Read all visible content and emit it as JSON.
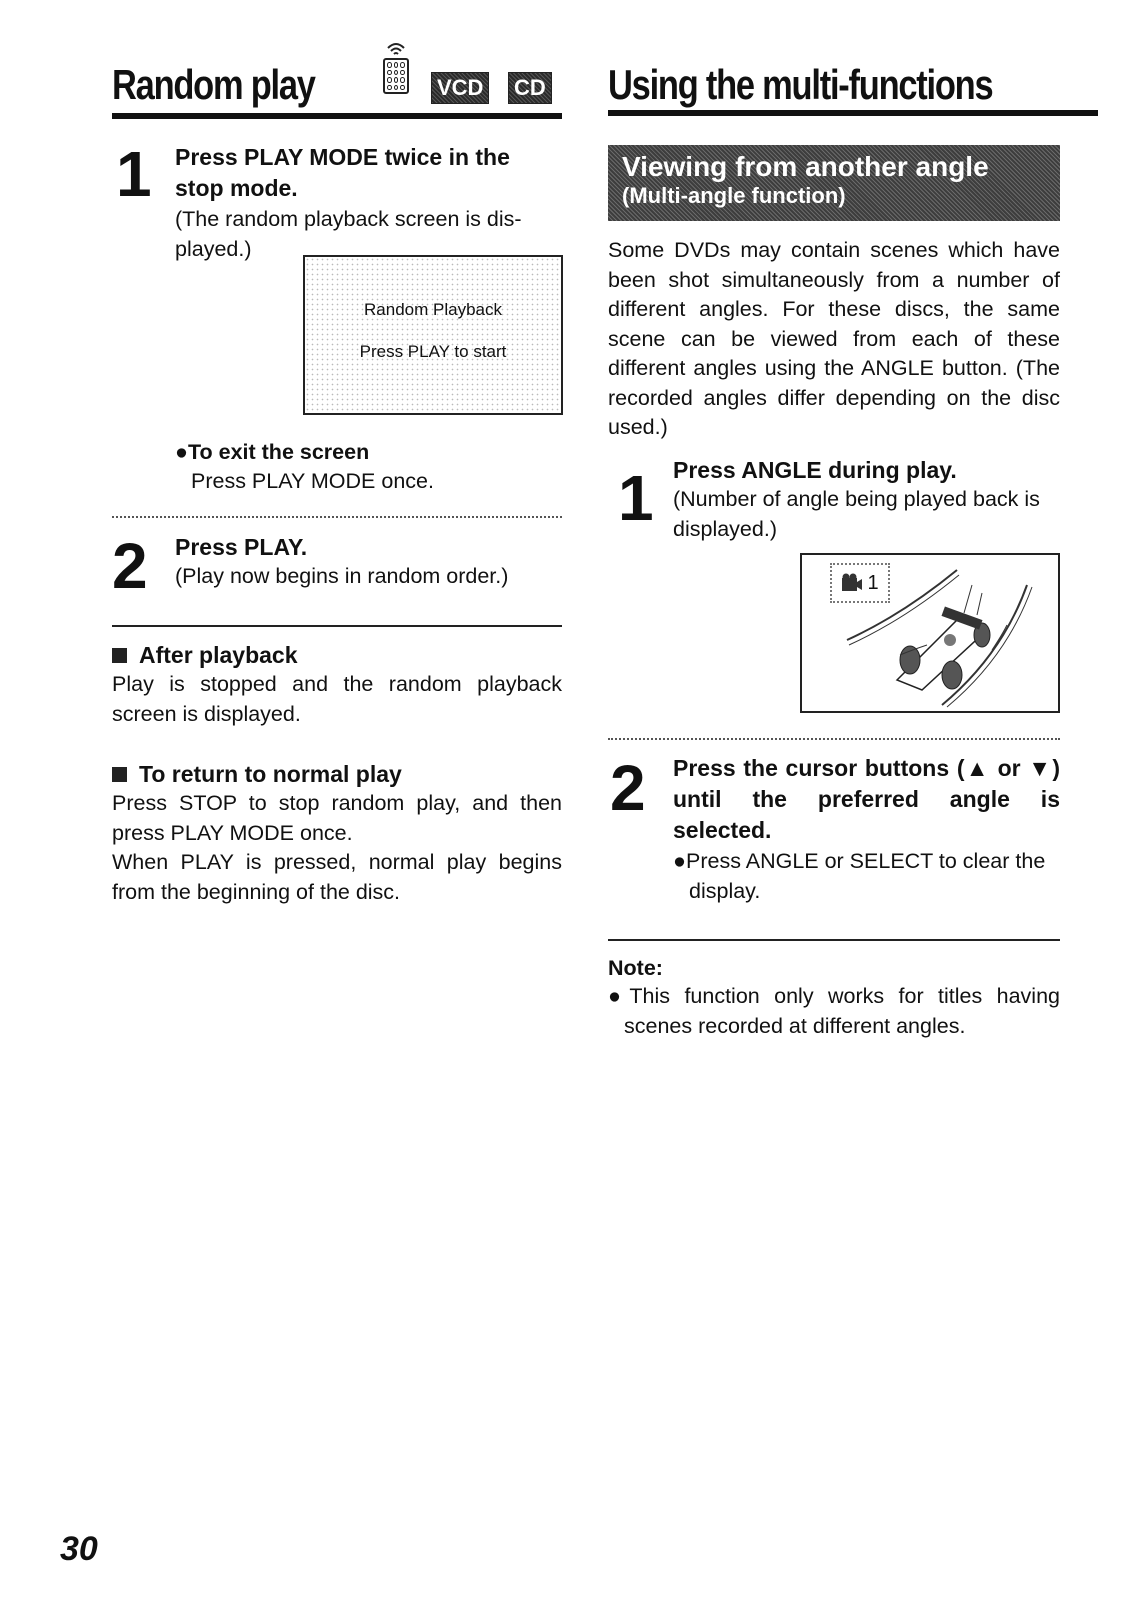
{
  "page_number": "30",
  "left": {
    "title": "Random play",
    "icons": [
      "remote-control-icon"
    ],
    "badges": [
      "VCD",
      "CD"
    ],
    "step1": {
      "number": "1",
      "heading": "Press PLAY MODE twice in the stop mode.",
      "heading_line1": "Press PLAY MODE twice in the",
      "heading_line2": "stop mode.",
      "body_line1": "(The random playback screen is dis-",
      "body_line2": "played.)",
      "screen": {
        "line1": "Random Playback",
        "line2": "Press PLAY to start"
      },
      "exit_heading": "●To exit the screen",
      "exit_body": "Press PLAY MODE once."
    },
    "step2": {
      "number": "2",
      "heading": "Press PLAY.",
      "body": "(Play now begins in random order.)"
    },
    "after_playback": {
      "heading": "After playback",
      "body": "Play is stopped and the random playback screen is displayed."
    },
    "return_normal": {
      "heading": "To return to normal play",
      "body1": "Press STOP to stop random play, and then press PLAY MODE once.",
      "body2": "When PLAY is pressed, normal play begins from the beginning of the disc."
    }
  },
  "right": {
    "title": "Using the multi-functions",
    "banner": {
      "line1": "Viewing from another angle",
      "line2": "(Multi-angle function)"
    },
    "intro": "Some DVDs may contain scenes which have been shot simultaneously from a number of different angles. For these discs, the same scene can be viewed from each of these different angles using the ANGLE button. (The recorded angles differ depending on the disc used.)",
    "step1": {
      "number": "1",
      "heading": "Press ANGLE during play.",
      "body": "(Number of angle being played back is displayed.)",
      "angle_display": "1"
    },
    "step2": {
      "number": "2",
      "heading": "Press the cursor buttons (▲ or ▼) until the preferred angle is selected.",
      "bullet": "●Press ANGLE or SELECT to clear the display."
    },
    "note": {
      "label": "Note:",
      "bullet": "●This function only works for titles having scenes recorded at different angles."
    }
  }
}
